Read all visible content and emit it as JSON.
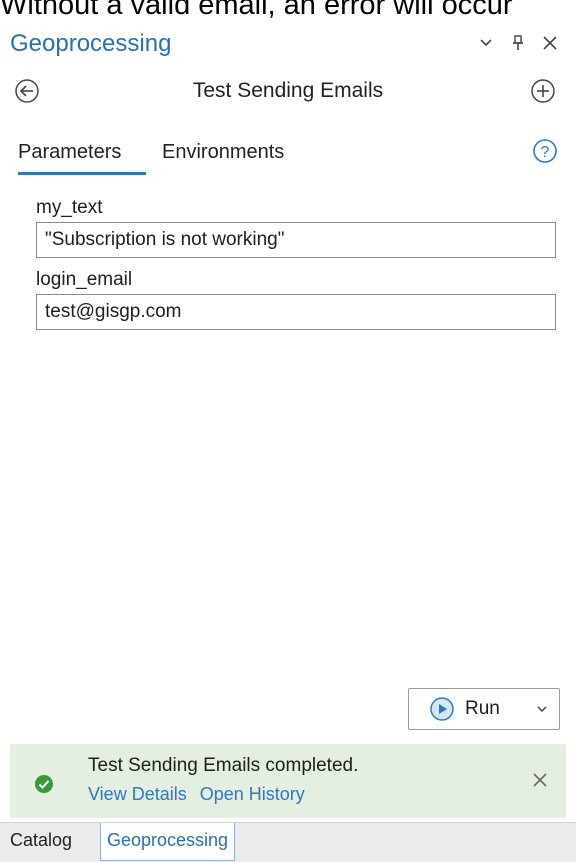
{
  "caption": "Without a valid email, an error will occur",
  "pane": {
    "title": "Geoprocessing",
    "header_icons": [
      "chevron-down-icon",
      "pin-icon",
      "close-icon"
    ]
  },
  "tool": {
    "title": "Test Sending Emails",
    "back_icon": "back-circle-icon",
    "add_icon": "add-circle-icon"
  },
  "tabs": [
    {
      "label": "Parameters",
      "active": true
    },
    {
      "label": "Environments",
      "active": false
    }
  ],
  "help_icon": "help-icon",
  "parameters": [
    {
      "label": "my_text",
      "value": "\"Subscription is not working\""
    },
    {
      "label": "login_email",
      "value": "test@gisgp.com"
    }
  ],
  "run": {
    "label": "Run",
    "icon": "play-circle-icon"
  },
  "status": {
    "message": "Test Sending Emails completed.",
    "links": [
      "View Details",
      "Open History"
    ],
    "state": "success"
  },
  "bottom_tabs": [
    {
      "label": "Catalog",
      "active": false
    },
    {
      "label": "Geoprocessing",
      "active": true
    }
  ],
  "colors": {
    "accent": "#2b79c2",
    "title_blue": "#2b6fb4",
    "success_bg": "#e4eee1",
    "success_icon": "#3a9a3a"
  }
}
